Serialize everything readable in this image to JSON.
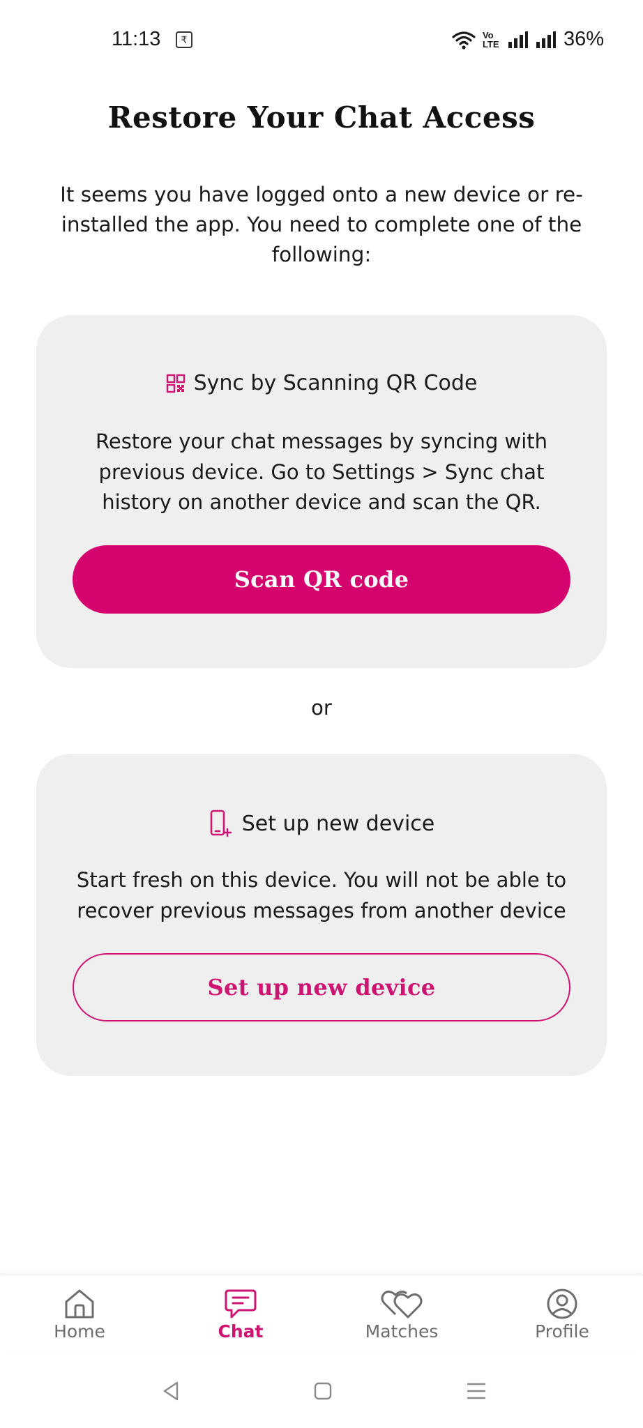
{
  "status_bar": {
    "time": "11:13",
    "notification_glyph": "₹",
    "network_label": "Vo\nLTE",
    "battery": "36%",
    "icons": [
      "wifi-icon",
      "volte-icon",
      "signal-icon",
      "signal-icon",
      "battery-text"
    ]
  },
  "page": {
    "title": "Restore Your Chat Access",
    "intro": "It seems you have logged onto a new device or re-installed the app. You need to complete one of the following:"
  },
  "sync_card": {
    "icon": "qr-code-icon",
    "heading": "Sync by Scanning QR Code",
    "description": "Restore your chat messages by syncing with previous device. Go to Settings > Sync chat history on another device and scan the QR.",
    "button_label": "Scan QR code"
  },
  "separator": "or",
  "new_device_card": {
    "icon": "phone-add-icon",
    "heading": "Set up new device",
    "description": "Start fresh on this device. You will not be able to recover previous messages from another device",
    "button_label": "Set up new device"
  },
  "bottom_nav": {
    "items": [
      {
        "label": "Home",
        "icon": "home-icon",
        "active": false
      },
      {
        "label": "Chat",
        "icon": "chat-icon",
        "active": true
      },
      {
        "label": "Matches",
        "icon": "hearts-icon",
        "active": false
      },
      {
        "label": "Profile",
        "icon": "profile-icon",
        "active": false
      }
    ]
  },
  "colors": {
    "accent": "#d4036d",
    "accent_outline": "#cc1470",
    "card_bg": "#f0eff0",
    "nav_inactive": "#6d6d6d"
  }
}
